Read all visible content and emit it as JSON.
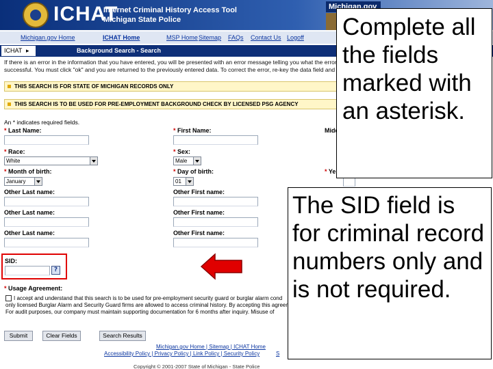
{
  "header": {
    "brand": "ICHAT",
    "subtitle_line1": "Internet Criminal History Access Tool",
    "subtitle_line2": "Michigan State Police",
    "state_logo": "Michigan.gov",
    "badge_icon": "police-badge-icon"
  },
  "nav": {
    "items": [
      {
        "label": "Michigan.gov Home"
      },
      {
        "label": "ICHAT Home"
      },
      {
        "label": "MSP Home"
      },
      {
        "label": "Sitemap"
      },
      {
        "label": "FAQs"
      },
      {
        "label": "Contact Us"
      },
      {
        "label": "Logoff"
      }
    ]
  },
  "breadcrumb": {
    "home": "ICHAT",
    "page_title": "Background Search - Search"
  },
  "error_message": {
    "line1": "If there is an error in the information that you have entered, you will be presented with an error message telling you what the error is or",
    "line2": "successful. You must click \"ok\" and you are returned to the previously entered data. To correct the error, re-key the data field and click"
  },
  "notices": [
    "THIS SEARCH IS FOR STATE OF MICHIGAN RECORDS ONLY",
    "THIS SEARCH IS TO BE USED FOR PRE-EMPLOYMENT BACKGROUND CHECK BY LICENSED PSG AGENCY"
  ],
  "required_note": "An * indicates required fields.",
  "form": {
    "star": "*",
    "last_name_label": "Last Name:",
    "first_name_label": "First Name:",
    "middle_label": "Midd",
    "race_label": "Race:",
    "race_value": "White",
    "sex_label": "Sex:",
    "sex_value": "Male",
    "month_label": "Month of birth:",
    "month_value": "January",
    "day_label": "Day of birth:",
    "day_value": "01",
    "year_label": "Ye",
    "other_last_label": "Other Last name:",
    "other_first_label": "Other First name:",
    "sid_label": "SID:",
    "help_label": "?",
    "usage_label": "Usage Agreement:",
    "usage_line1": "I accept and understand that this search is to be used for pre-employment security guard or burglar alarm cond",
    "usage_line2": "only licensed Burglar Alarm and Security Guard firms are allowed to access criminal history. By accepting this agreement",
    "usage_line3": "For audit purposes, our company must maintain supporting documentation for 6 months after inquiry. Misuse of"
  },
  "buttons": {
    "submit": "Submit",
    "clear": "Clear Fields",
    "results": "Search Results"
  },
  "footer": {
    "line1": "Michigan.gov Home | Sitemap | ICHAT Home",
    "line2": "Accessibility Policy | Privacy Policy | Link Policy | Security Policy",
    "line2_tail": "S",
    "copyright": "Copyright © 2001-2007 State of Michigan - State Police"
  },
  "callouts": {
    "top": "Complete all the fields marked with an asterisk.",
    "bottom": "The SID field is for criminal record numbers only and is not required."
  },
  "colors": {
    "header_blue": "#0a2f7a",
    "highlight_red": "#e00000",
    "notice_yellow": "#fff6c8"
  }
}
